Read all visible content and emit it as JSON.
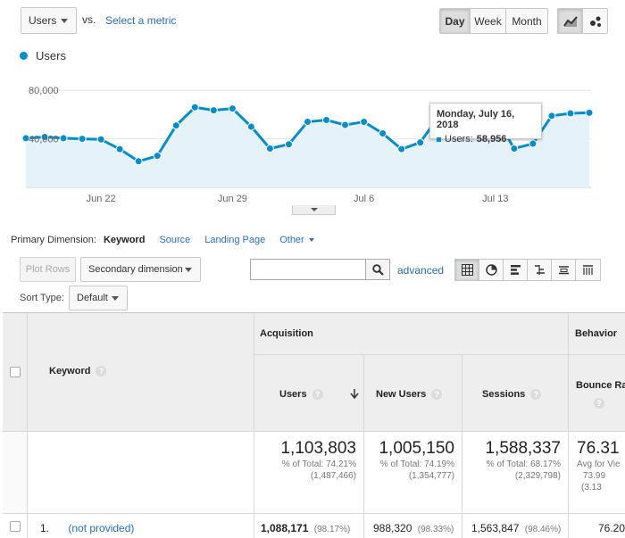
{
  "controls": {
    "metric": "Users",
    "vs": "vs.",
    "select_metric": "Select a metric",
    "granularity": [
      "Day",
      "Week",
      "Month"
    ],
    "granularity_active": "Day"
  },
  "legend": {
    "label": "Users",
    "color": "#058dc7"
  },
  "chart_data": {
    "type": "area",
    "series": [
      {
        "name": "Users",
        "values": [
          40500,
          41500,
          40500,
          40000,
          39500,
          31500,
          21500,
          26000,
          51000,
          66000,
          63500,
          65000,
          50000,
          32000,
          35500,
          54000,
          55500,
          51500,
          54000,
          44500,
          31500,
          37000,
          59000,
          60000,
          60000,
          58500,
          32000,
          36000,
          58956,
          61000,
          61500
        ]
      }
    ],
    "x_tick_labels": [
      "Jun 22",
      "Jun 29",
      "Jul 6",
      "Jul 13"
    ],
    "y_tick_labels": [
      "80,000",
      "40,000"
    ],
    "ylim": [
      0,
      100000
    ]
  },
  "tooltip": {
    "date": "Monday, July 16, 2018",
    "metric": "Users:",
    "value": "58,956"
  },
  "primary_dimension": {
    "label": "Primary Dimension:",
    "current": "Keyword",
    "options": [
      "Source",
      "Landing Page"
    ],
    "other": "Other"
  },
  "toolbar": {
    "plot_rows": "Plot Rows",
    "secondary_dimension": "Secondary dimension",
    "search_value": "",
    "advanced": "advanced",
    "sort_type_label": "Sort Type:",
    "sort_type_value": "Default"
  },
  "table": {
    "keyword_header": "Keyword",
    "group_acquisition": "Acquisition",
    "group_behavior": "Behavior",
    "columns": [
      "Users",
      "New Users",
      "Sessions",
      "Bounce Rat"
    ],
    "totals": [
      {
        "value": "1,103,803",
        "pct": "% of Total: 74.21%",
        "of": "(1,487,466)"
      },
      {
        "value": "1,005,150",
        "pct": "% of Total: 74.19%",
        "of": "(1,354,777)"
      },
      {
        "value": "1,588,337",
        "pct": "% of Total: 68.17%",
        "of": "(2,329,798)"
      },
      {
        "value": "76.31",
        "pct": "Avg for Vie",
        "of": "73.99",
        "extra": "(3.13"
      }
    ],
    "rows": [
      {
        "index": "1.",
        "keyword": "(not provided)",
        "users": "1,088,171",
        "users_pct": "(98.17%)",
        "new_users": "988,320",
        "new_users_pct": "(98.33%)",
        "sessions": "1,563,847",
        "sessions_pct": "(98.46%)",
        "bounce": "76.20"
      }
    ]
  }
}
